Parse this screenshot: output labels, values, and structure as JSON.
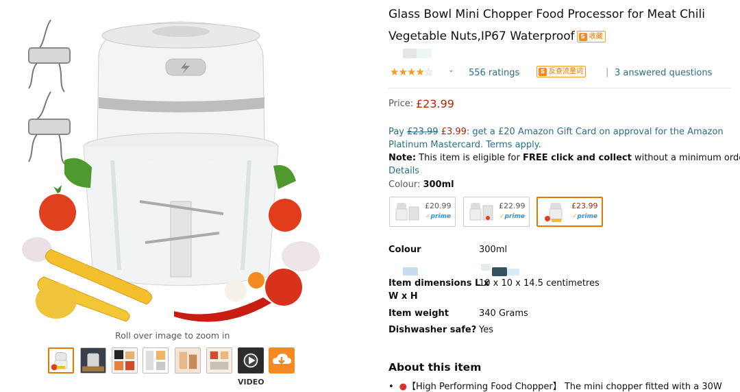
{
  "gallery": {
    "zoom_hint": "Roll over image to zoom in",
    "video_label": "VIDEO",
    "thumbnail_count": 8
  },
  "product": {
    "title_line1": "Glass Bowl Mini Chopper Food Processor for Meat Chili",
    "title_line2": "Vegetable Nuts,IP67 Waterproof",
    "collect_badge": "收藏",
    "rating_stars": 4.0,
    "ratings_text": "556 ratings",
    "check_badge": "反查流量词",
    "separator": "|",
    "questions_text": "3 answered questions",
    "price_label": "Price:",
    "price": "£23.99"
  },
  "promo": {
    "pay_prefix": "Pay ",
    "old_price": "£23.99",
    "new_price": "£3.99",
    "pay_rest": ": get a £20 Amazon Gift Card on approval for the Amazon",
    "line2": "Platinum Mastercard. Terms apply.",
    "note_label": "Note:",
    "note_pre": " This item is eligible for ",
    "note_bold": "FREE click and collect",
    "note_post": " without a minimum order.",
    "details_link": "Details"
  },
  "colour": {
    "label": "Colour: ",
    "selected": "300ml",
    "options": [
      {
        "price": "£20.99",
        "prime": "prime"
      },
      {
        "price": "£22.99",
        "prime": "prime"
      },
      {
        "price": "£23.99",
        "prime": "prime"
      }
    ],
    "prime_check": "✓"
  },
  "specs": [
    {
      "label": "Colour",
      "value": "300ml"
    },
    {
      "label": "Item dimensions L x",
      "label2": "W x H",
      "value": "10 x 10 x 14.5 centimetres"
    },
    {
      "label": "Item weight",
      "value": "340 Grams"
    },
    {
      "label": "Dishwasher safe?",
      "value": "Yes"
    }
  ],
  "about": {
    "heading": "About this item",
    "bullet_dot": "•",
    "bullet1": "【High Performing Food Chopper】 The mini chopper fitted with a 30W"
  },
  "colors": {
    "link": "#2b6f87",
    "price": "#b12704",
    "star": "#f29c1f",
    "selected_border": "#e77600"
  }
}
